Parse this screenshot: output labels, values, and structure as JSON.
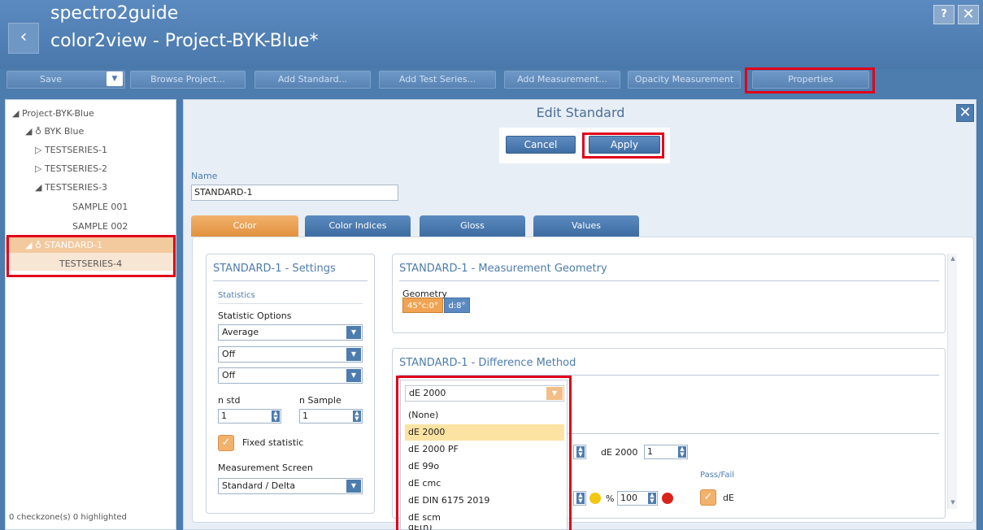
{
  "app": {
    "title_line1": "spectro2guide",
    "title_line2": "color2view - Project-BYK-Blue*",
    "help_label": "?",
    "close_label": "✕",
    "back_label": "‹"
  },
  "toolbar": {
    "save": "Save",
    "browse_project": "Browse Project...",
    "add_standard": "Add Standard...",
    "add_test_series": "Add Test Series...",
    "add_measurement": "Add Measurement...",
    "opacity_measurement": "Opacity Measurement",
    "properties": "Properties"
  },
  "tree": {
    "items": [
      {
        "label": "◢ Project-BYK-Blue"
      },
      {
        "label": "◢ ♁ BYK Blue"
      },
      {
        "label": "▷ TESTSERIES-1"
      },
      {
        "label": "▷ TESTSERIES-2"
      },
      {
        "label": "◢ TESTSERIES-3"
      },
      {
        "label": "SAMPLE 001"
      },
      {
        "label": "SAMPLE 002"
      },
      {
        "label": "◢ ♁ STANDARD-1"
      },
      {
        "label": "TESTSERIES-4"
      }
    ],
    "status": "0 checkzone(s) 0 highlighted"
  },
  "edit": {
    "title": "Edit Standard",
    "cancel": "Cancel",
    "apply": "Apply",
    "name_label": "Name",
    "name_value": "STANDARD-1"
  },
  "tabs": [
    {
      "label": "Color"
    },
    {
      "label": "Color Indices"
    },
    {
      "label": "Gloss"
    },
    {
      "label": "Values"
    }
  ],
  "settings": {
    "title": "STANDARD-1 - Settings",
    "statistics_heading": "Statistics",
    "statistic_options_label": "Statistic Options",
    "select1": "Average",
    "select2": "Off",
    "select3": "Off",
    "n_std_label": "n std",
    "n_sample_label": "n Sample",
    "n_std_value": "1",
    "n_sample_value": "1",
    "fixed_statistic": "Fixed statistic",
    "measurement_screen_label": "Measurement Screen",
    "measurement_screen_value": "Standard / Delta"
  },
  "geometry": {
    "title": "STANDARD-1 - Measurement Geometry",
    "label": "Geometry",
    "opt1": "45°c:0°",
    "opt2": "d:8°"
  },
  "difference": {
    "title": "STANDARD-1 - Difference Method",
    "selected": "dE 2000",
    "de2000_label": "dE 2000",
    "de2000_value": "1",
    "pass_fail_label": "Pass/Fail",
    "percent_label": "%",
    "percent_value": "100",
    "de_check_label": "dE",
    "options": [
      "(None)",
      "dE 2000",
      "dE 2000 PF",
      "dE 99o",
      "dE cmc",
      "dE DIN 6175 2019",
      "dE scm",
      "dE(h)"
    ]
  },
  "colors": {
    "accent_orange": "#e2913f",
    "brand_blue": "#4d7cae",
    "highlight_red": "#e0001a",
    "yellow_dot": "#f2c80f",
    "red_dot": "#d8241c"
  }
}
